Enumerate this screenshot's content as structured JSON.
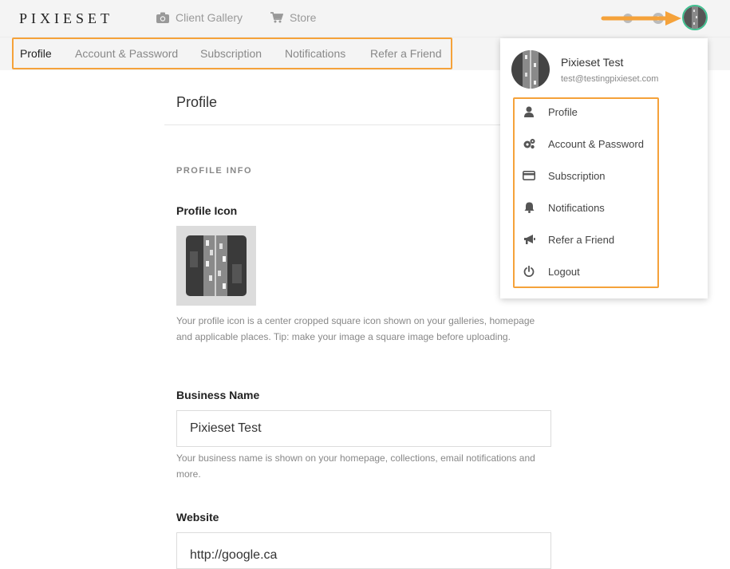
{
  "header": {
    "logo": "PIXIESET",
    "nav": [
      {
        "label": "Client Gallery",
        "icon": "camera-icon"
      },
      {
        "label": "Store",
        "icon": "cart-icon"
      }
    ]
  },
  "subnav": {
    "items": [
      {
        "label": "Profile",
        "active": true
      },
      {
        "label": "Account & Password",
        "active": false
      },
      {
        "label": "Subscription",
        "active": false
      },
      {
        "label": "Notifications",
        "active": false
      },
      {
        "label": "Refer a Friend",
        "active": false
      }
    ]
  },
  "main": {
    "page_title": "Profile",
    "section_label": "PROFILE INFO",
    "profile_icon": {
      "label": "Profile Icon",
      "help": "Your profile icon is a center cropped square icon shown on your galleries, homepage and applicable places. Tip: make your image a square image before uploading."
    },
    "business_name": {
      "label": "Business Name",
      "value": "Pixieset Test",
      "help": "Your business name is shown on your homepage, collections, email notifications and more."
    },
    "website": {
      "label": "Website",
      "value": "http://google.ca"
    }
  },
  "dropdown": {
    "name": "Pixieset Test",
    "email": "test@testingpixieset.com",
    "items": [
      {
        "label": "Profile",
        "icon": "user-icon"
      },
      {
        "label": "Account & Password",
        "icon": "gears-icon"
      },
      {
        "label": "Subscription",
        "icon": "credit-card-icon"
      },
      {
        "label": "Notifications",
        "icon": "bell-icon"
      },
      {
        "label": "Refer a Friend",
        "icon": "megaphone-icon"
      },
      {
        "label": "Logout",
        "icon": "power-icon"
      }
    ]
  },
  "colors": {
    "highlight": "#f5a23a",
    "avatar_ring": "#3fbf8f"
  }
}
